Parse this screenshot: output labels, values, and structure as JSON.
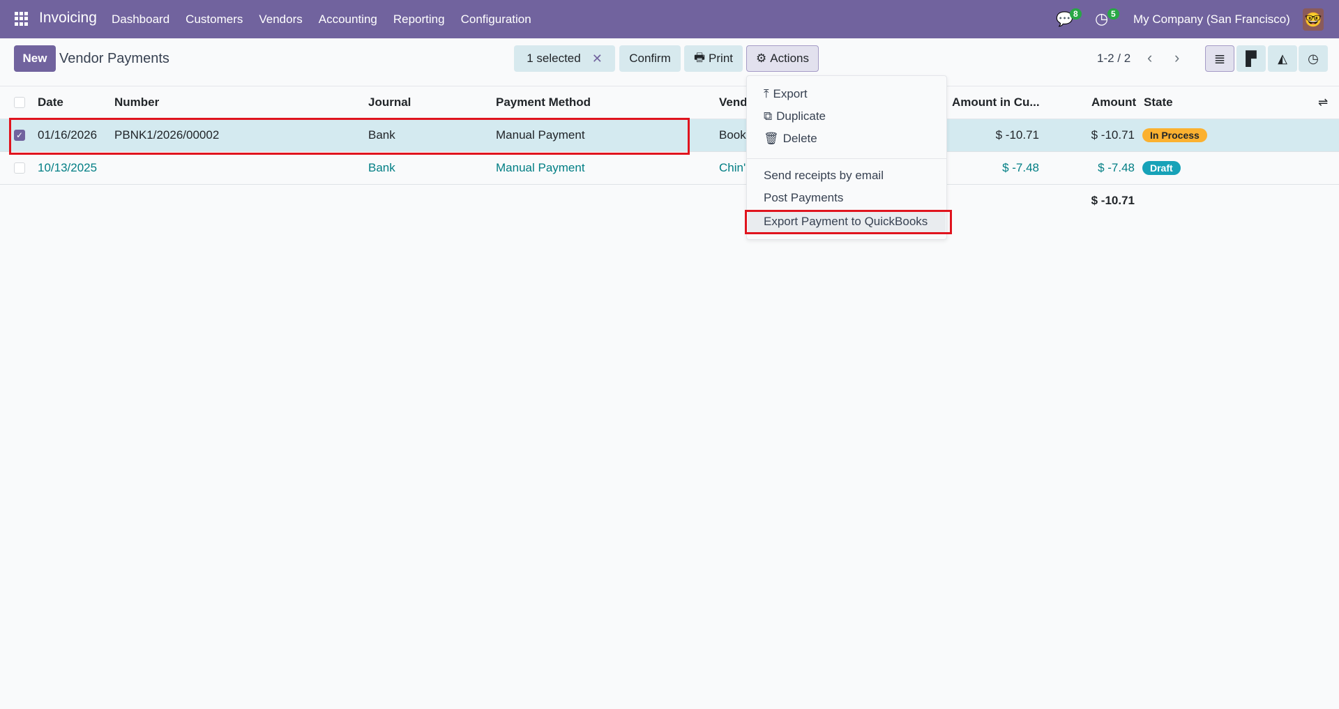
{
  "nav": {
    "app": "Invoicing",
    "menu": [
      "Dashboard",
      "Customers",
      "Vendors",
      "Accounting",
      "Reporting",
      "Configuration"
    ],
    "messages_count": "8",
    "activities_count": "5",
    "company": "My Company (San Francisco)"
  },
  "control": {
    "new_label": "New",
    "title": "Vendor Payments",
    "selected": "1 selected",
    "confirm": "Confirm",
    "print": "Print",
    "actions": "Actions",
    "pager": "1-2 / 2"
  },
  "columns": [
    "Date",
    "Number",
    "Journal",
    "Payment Method",
    "Vend",
    "Amount in Cu...",
    "Amount",
    "State"
  ],
  "rows": [
    {
      "date": "01/16/2026",
      "number": "PBNK1/2026/00002",
      "journal": "Bank",
      "method": "Manual Payment",
      "vendor": "Book",
      "amount_cur": "$ -10.71",
      "amount": "$ -10.71",
      "state": "In Process",
      "selected": true
    },
    {
      "date": "10/13/2025",
      "number": "",
      "journal": "Bank",
      "method": "Manual Payment",
      "vendor": "Chin'",
      "amount_cur": "$ -7.48",
      "amount": "$ -7.48",
      "state": "Draft",
      "selected": false
    }
  ],
  "total": "$ -10.71",
  "actions_menu": {
    "export": "Export",
    "duplicate": "Duplicate",
    "delete": "Delete",
    "send": "Send receipts by email",
    "post": "Post Payments",
    "quickbooks": "Export Payment to QuickBooks"
  },
  "colors": {
    "navbar": "#71639e",
    "in_process": "#fbb130",
    "draft": "#17a2b8",
    "highlight": "#e0141e"
  }
}
